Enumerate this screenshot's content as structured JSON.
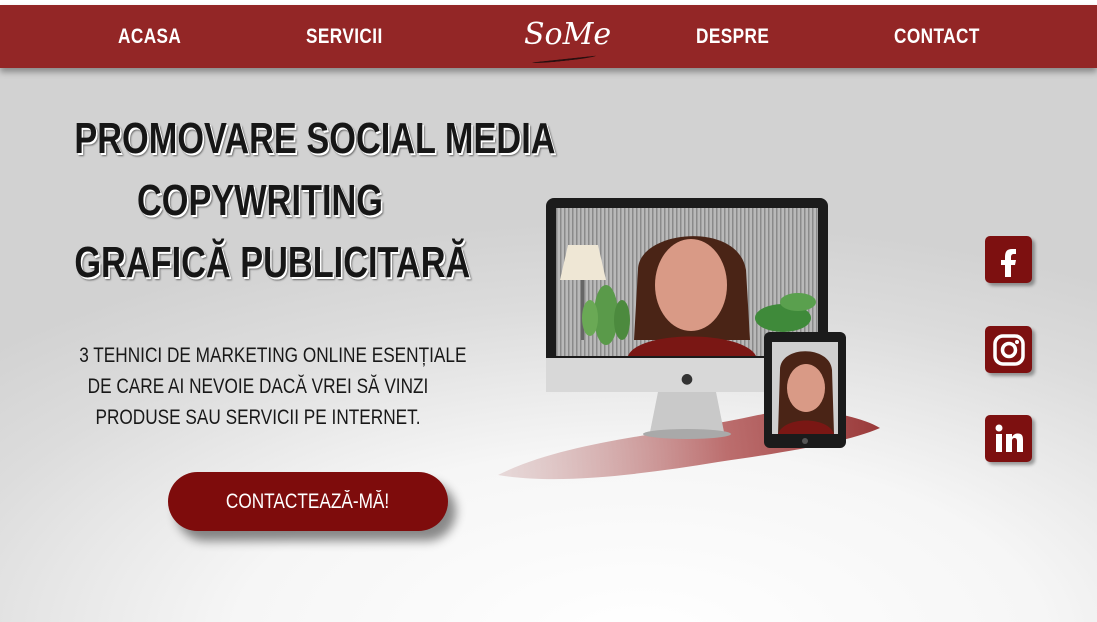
{
  "nav": {
    "items": [
      {
        "label": "ACASA"
      },
      {
        "label": "SERVICII"
      },
      {
        "label": "DESPRE"
      },
      {
        "label": "CONTACT"
      }
    ],
    "logo_text": "SoMe"
  },
  "hero": {
    "headline_lines": [
      "PROMOVARE SOCIAL MEDIA",
      "COPYWRITING",
      "GRAFICĂ PUBLICITARĂ"
    ],
    "subtext_lines": [
      "3 TEHNICI DE MARKETING ONLINE ESENȚIALE",
      "DE CARE AI NEVOIE DACĂ VREI SĂ VINZI",
      "PRODUSE SAU SERVICII PE INTERNET."
    ],
    "cta_label": "CONTACTEAZĂ-MĂ!"
  },
  "social": [
    {
      "icon": "facebook-icon"
    },
    {
      "icon": "instagram-icon"
    },
    {
      "icon": "linkedin-icon"
    }
  ],
  "colors": {
    "brand": "#932626",
    "button": "#7e0c0c",
    "social": "#7d1010"
  }
}
